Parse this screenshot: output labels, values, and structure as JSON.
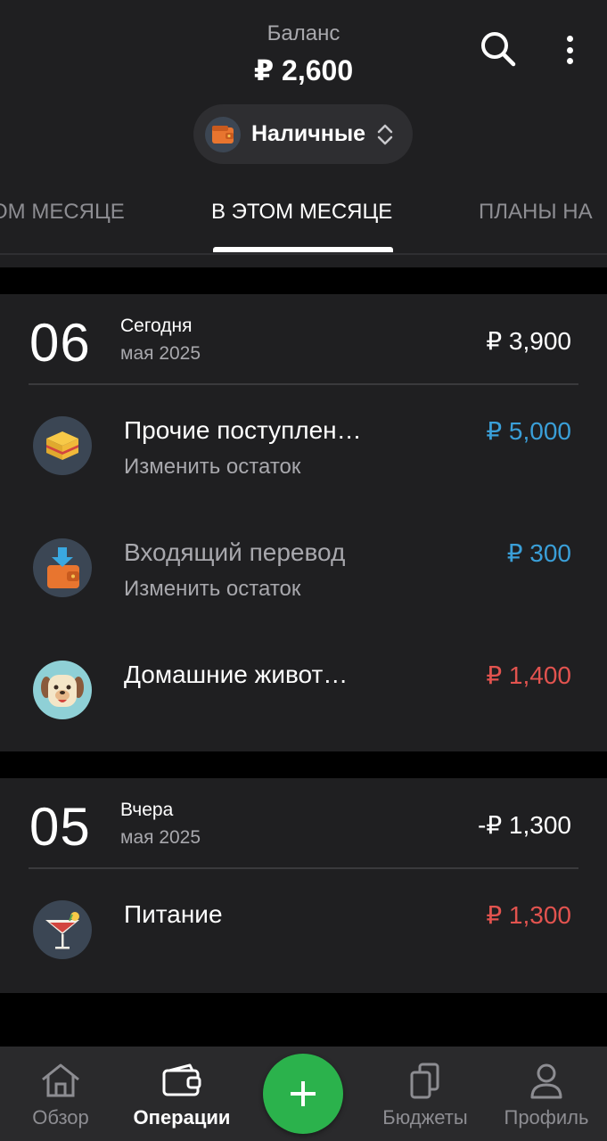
{
  "header": {
    "balance_label": "Баланс",
    "balance_value": "₽ 2,600",
    "search_icon": "search-icon",
    "more_icon": "more-vertical-icon"
  },
  "account": {
    "name": "Наличные",
    "icon": "wallet-icon"
  },
  "tabs": [
    {
      "label": "ОМ МЕСЯЦЕ",
      "active": false
    },
    {
      "label": "В ЭТОМ МЕСЯЦЕ",
      "active": true
    },
    {
      "label": "ПЛАНЫ НА",
      "active": false
    }
  ],
  "days": [
    {
      "day": "06",
      "word": "Сегодня",
      "month": "мая 2025",
      "total": "₽ 3,900",
      "transactions": [
        {
          "title": "Прочие поступлен…",
          "subtitle": "Изменить остаток",
          "amount": "₽ 5,000",
          "kind": "income",
          "icon": "box-icon"
        },
        {
          "title": "Входящий перевод",
          "subtitle": "Изменить остаток",
          "amount": "₽ 300",
          "kind": "income",
          "icon": "incoming-transfer-icon"
        },
        {
          "title": "Домашние живот…",
          "subtitle": "",
          "amount": "₽ 1,400",
          "kind": "expense",
          "icon": "dog-icon"
        }
      ]
    },
    {
      "day": "05",
      "word": "Вчера",
      "month": "мая 2025",
      "total": "-₽ 1,300",
      "transactions": [
        {
          "title": "Питание",
          "subtitle": "",
          "amount": "₽ 1,300",
          "kind": "expense",
          "icon": "cocktail-icon"
        }
      ]
    }
  ],
  "bottom_nav": [
    {
      "label": "Обзор",
      "icon": "home-icon",
      "active": false
    },
    {
      "label": "Операции",
      "icon": "wallet-icon",
      "active": true
    },
    {
      "label": "Бюджеты",
      "icon": "budgets-icon",
      "active": false
    },
    {
      "label": "Профиль",
      "icon": "profile-icon",
      "active": false
    }
  ],
  "fab": {
    "icon": "plus-icon"
  },
  "colors": {
    "income": "#3a9fd8",
    "expense": "#e2534f",
    "fab": "#2bb24c",
    "background": "#1f1f21"
  }
}
